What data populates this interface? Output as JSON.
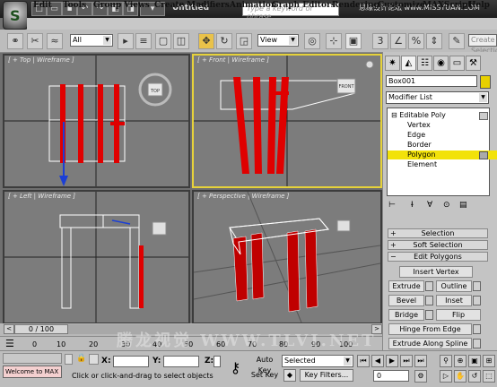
{
  "app": {
    "title": "Untitled",
    "search_placeholder": "Type a keyword or phrase",
    "site_watermark": "思缘设计论坛 www.MISSYUAN.COM",
    "bottom_watermark": "腾龙视觉 WWW.TLVI.NET"
  },
  "menu": [
    "Edit",
    "Tools",
    "Group",
    "Views",
    "Create",
    "Modifiers",
    "Animation",
    "Graph Editors",
    "Rendering",
    "Customize",
    "MAXScript",
    "Help"
  ],
  "toolbar": {
    "selection_filter": "All",
    "reference_coord": "View",
    "named_selection": "Create Selection Se"
  },
  "viewports": {
    "top": "[ + Top | Wireframe ]",
    "front": "[ + Front | Wireframe ]",
    "left": "[ + Left | Wireframe ]",
    "perspective": "[ + Perspective | Wireframe ]",
    "viewcube_top": "TOP",
    "viewcube_front": "FRONT"
  },
  "command_panel": {
    "object_name": "Box001",
    "modifier_list": "Modifier List",
    "stack": {
      "root": "Editable Poly",
      "items": [
        "Vertex",
        "Edge",
        "Border",
        "Polygon",
        "Element"
      ],
      "selected": "Polygon"
    },
    "rollouts": {
      "selection": "Selection",
      "soft_selection": "Soft Selection",
      "edit_polygons": "Edit Polygons"
    },
    "buttons": {
      "insert_vertex": "Insert Vertex",
      "extrude": "Extrude",
      "outline": "Outline",
      "bevel": "Bevel",
      "inset": "Inset",
      "bridge": "Bridge",
      "flip": "Flip",
      "hinge": "Hinge From Edge",
      "extrude_spline": "Extrude Along Spline"
    }
  },
  "timeline": {
    "slider": "0 / 100",
    "ticks": [
      "0",
      "10",
      "20",
      "30",
      "40",
      "50",
      "60",
      "70",
      "80",
      "90",
      "100"
    ]
  },
  "status": {
    "maxscript": "Welcome to MAX",
    "prompt": "Click or click-and-drag to select objects",
    "x_label": "X:",
    "y_label": "Y:",
    "z_label": "Z:",
    "auto_key": "Auto Key",
    "set_key": "Set Key",
    "key_mode": "Selected",
    "key_filters": "Key Filters...",
    "frame": "0"
  }
}
